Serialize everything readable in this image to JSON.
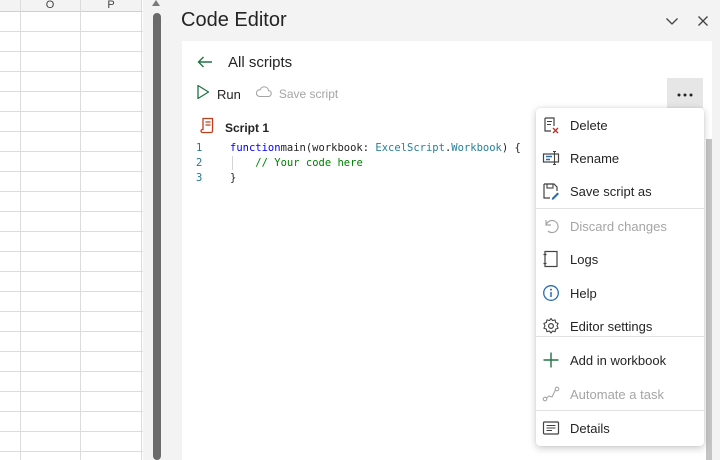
{
  "sheet": {
    "columns": [
      "O",
      "P"
    ]
  },
  "pane": {
    "title": "Code Editor",
    "collapse_icon": "chevron-down-icon",
    "close_icon": "close-icon"
  },
  "nav": {
    "back_icon": "arrow-left-icon",
    "title": "All scripts"
  },
  "toolbar": {
    "run_label": "Run",
    "save_label": "Save script",
    "more_icon": "more-horizontal-icon"
  },
  "script": {
    "name": "Script 1",
    "icon": "script-file-icon"
  },
  "editor": {
    "lines": [
      {
        "num": "1",
        "parts": [
          [
            "kw",
            "function"
          ],
          [
            "",
            "main(workbook: "
          ],
          [
            "ty",
            "ExcelScript"
          ],
          [
            "",
            "."
          ],
          [
            "ty",
            "Workbook"
          ],
          [
            "",
            ") {"
          ]
        ]
      },
      {
        "num": "2",
        "parts": [
          [
            "",
            "    "
          ],
          [
            "cm",
            "// Your code here"
          ]
        ]
      },
      {
        "num": "3",
        "parts": [
          [
            "",
            "}"
          ]
        ]
      }
    ]
  },
  "menu": {
    "items": [
      {
        "label": "Delete",
        "icon": "delete-icon",
        "enabled": true
      },
      {
        "label": "Rename",
        "icon": "rename-icon",
        "enabled": true
      },
      {
        "label": "Save script as",
        "icon": "save-as-icon",
        "enabled": true
      },
      {
        "label": "Discard changes",
        "icon": "undo-icon",
        "enabled": false
      },
      {
        "label": "Logs",
        "icon": "logs-icon",
        "enabled": true
      },
      {
        "label": "Help",
        "icon": "info-icon",
        "enabled": true
      },
      {
        "label": "Editor settings",
        "icon": "gear-icon",
        "enabled": true
      },
      {
        "label": "Add in workbook",
        "icon": "plus-icon",
        "enabled": true
      },
      {
        "label": "Automate a task",
        "icon": "flow-icon",
        "enabled": false
      },
      {
        "label": "Details",
        "icon": "details-icon",
        "enabled": true
      }
    ]
  },
  "colors": {
    "accent_green": "#217346",
    "script_icon": "#c43e1c",
    "disabled_text": "#a5a5a5"
  }
}
